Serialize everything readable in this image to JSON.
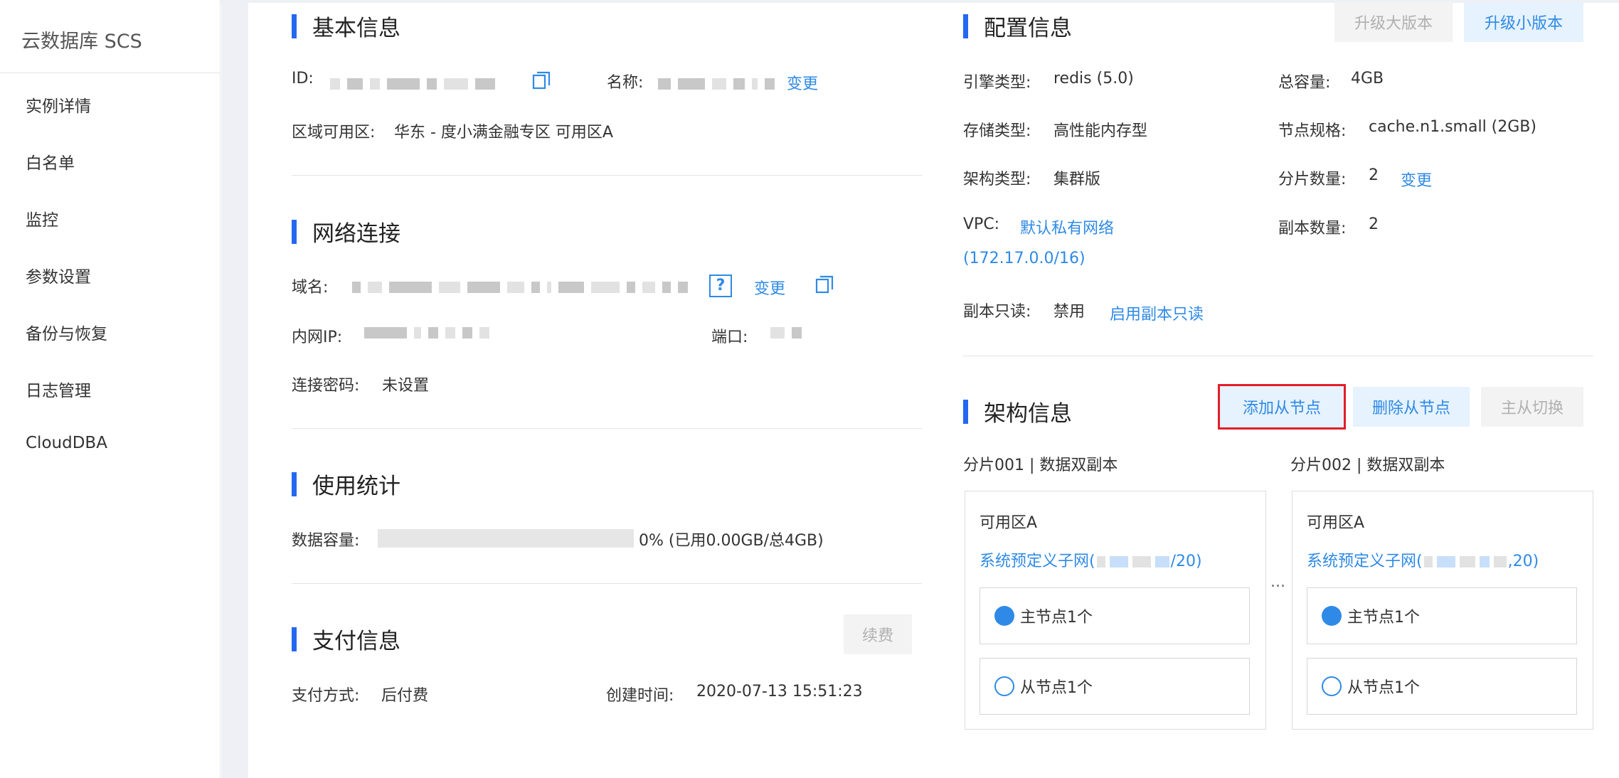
{
  "sidebar": {
    "title": "云数据库 SCS",
    "items": [
      {
        "label": "实例详情"
      },
      {
        "label": "白名单"
      },
      {
        "label": "监控"
      },
      {
        "label": "参数设置"
      },
      {
        "label": "备份与恢复"
      },
      {
        "label": "日志管理"
      },
      {
        "label": "CloudDBA"
      }
    ]
  },
  "basic": {
    "title": "基本信息",
    "id_label": "ID:",
    "name_label": "名称:",
    "change": "变更",
    "zone_label": "区域可用区:",
    "zone_value": "华东 - 度小满金融专区 可用区A"
  },
  "network": {
    "title": "网络连接",
    "domain_label": "域名:",
    "help": "?",
    "change": "变更",
    "ip_label": "内网IP:",
    "port_label": "端口:",
    "password_label": "连接密码:",
    "password_value": "未设置"
  },
  "usage": {
    "title": "使用统计",
    "capacity_label": "数据容量:",
    "capacity_percent": 0,
    "capacity_text": "0% (已用0.00GB/总4GB)"
  },
  "payment": {
    "title": "支付信息",
    "renew": "续费",
    "method_label": "支付方式:",
    "method_value": "后付费",
    "created_label": "创建时间:",
    "created_value": "2020-07-13 15:51:23"
  },
  "config": {
    "title": "配置信息",
    "upgrade_major": "升级大版本",
    "upgrade_minor": "升级小版本",
    "engine_label": "引擎类型:",
    "engine_value": "redis (5.0)",
    "total_label": "总容量:",
    "total_value": "4GB",
    "storage_label": "存储类型:",
    "storage_value": "高性能内存型",
    "spec_label": "节点规格:",
    "spec_value": "cache.n1.small (2GB)",
    "arch_label": "架构类型:",
    "arch_value": "集群版",
    "shards_label": "分片数量:",
    "shards_value": "2",
    "shards_change": "变更",
    "vpc_label": "VPC:",
    "vpc_value": "默认私有网络",
    "vpc_cidr": "(172.17.0.0/16)",
    "replicas_label": "副本数量:",
    "replicas_value": "2",
    "readonly_label": "副本只读:",
    "readonly_value": "禁用",
    "readonly_enable": "启用副本只读"
  },
  "architecture": {
    "title": "架构信息",
    "add_slave": "添加从节点",
    "remove_slave": "删除从节点",
    "switch": "主从切换",
    "ellipsis": "...",
    "shards": [
      {
        "title": "分片001 | 数据双副本",
        "zone": "可用区A",
        "subnet_prefix": "系统预定义子网(",
        "subnet_suffix": "/20)",
        "master": "主节点1个",
        "slave": "从节点1个"
      },
      {
        "title": "分片002 | 数据双副本",
        "zone": "可用区A",
        "subnet_prefix": "系统预定义子网(",
        "subnet_suffix": ",20)",
        "master": "主节点1个",
        "slave": "从节点1个"
      }
    ]
  },
  "colors": {
    "accent": "#2468f2",
    "link": "#2e8ae6",
    "highlight_border": "#e21e2a"
  }
}
